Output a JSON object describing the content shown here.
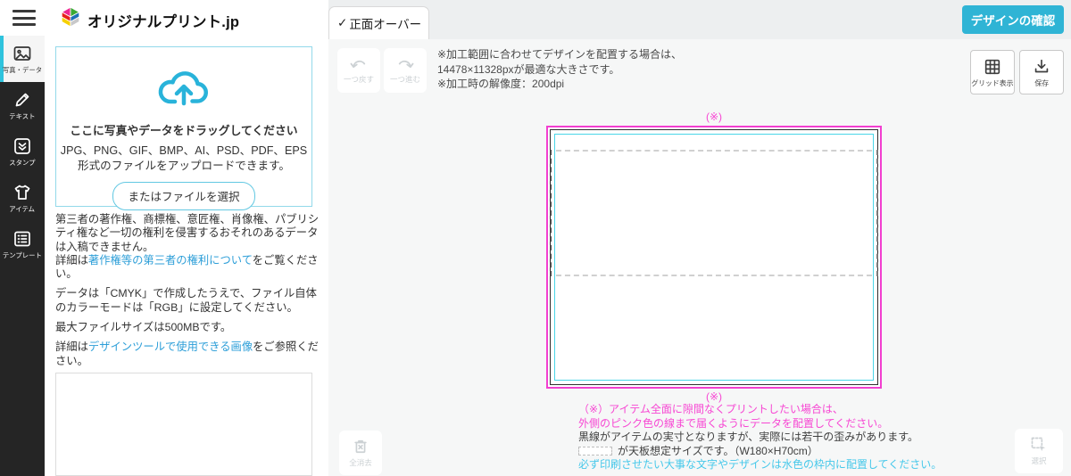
{
  "colors": {
    "accent_cyan": "#2fb4d5",
    "sidebar_active_cyan": "#2fc3dd",
    "link_blue": "#2c9ed8",
    "magenta_guide": "#f23fd0",
    "canvas_cyan_line": "#49d5e8",
    "note_cyan": "#46c8ea",
    "item_outline_black": "#2e2e2e"
  },
  "header": {
    "brand": "オリジナルプリント.jp",
    "confirm_button_label": "デザインの確認"
  },
  "tab": {
    "check": "✓",
    "label": "正面オーバー"
  },
  "sidebar": {
    "items": [
      {
        "label": "写真・データ",
        "icon": "photo-icon",
        "active": true
      },
      {
        "label": "テキスト",
        "icon": "pencil-icon",
        "active": false
      },
      {
        "label": "スタンプ",
        "icon": "stamp-icon",
        "active": false
      },
      {
        "label": "アイテム",
        "icon": "tshirt-icon",
        "active": false
      },
      {
        "label": "テンプレート",
        "icon": "template-icon",
        "active": false
      }
    ]
  },
  "upload_panel": {
    "dropzone_title": "ここに写真やデータをドラッグしてください",
    "formats_line1": "JPG、PNG、GIF、BMP、AI、PSD、PDF、EPS",
    "formats_line2": "形式のファイルをアップロードできます。",
    "select_file_button": "またはファイルを選択",
    "rights_paragraph": "第三者の著作権、商標権、意匠権、肖像権、パブリシティ権など一切の権利を侵害するおそれのあるデータは入稿できません。",
    "rights_detail_prefix": "詳細は",
    "rights_detail_link": "著作権等の第三者の権利について",
    "rights_detail_suffix": "をご覧ください。",
    "color_mode_paragraph": "データは「CMYK」で作成したうえで、ファイル自体のカラーモードは「RGB」に設定してください。",
    "max_file_size": "最大ファイルサイズは500MBです。",
    "detail_prefix": "詳細は",
    "detail_link": "デザインツールで使用できる画像",
    "detail_suffix": "をご参照ください。"
  },
  "toolbar": {
    "undo_label": "一つ戻す",
    "redo_label": "一つ進む",
    "grid_button_label": "グリッド表示",
    "save_button_label": "保存",
    "info_line1": "※加工範囲に合わせてデザインを配置する場合は、",
    "info_line2": "14478×11328pxが最適な大きさです。",
    "info_line3": "※加工時の解像度：200dpi"
  },
  "canvas": {
    "top_marker": "(※)",
    "bottom_marker": "(※)",
    "notes": {
      "line1": "（※）アイテム全面に隙間なくプリントしたい場合は、",
      "line2": "外側のピンク色の線まで届くようにデータを配置してください。",
      "line3": "黒線がアイテムの実寸となりますが、実際には若干の歪みがあります。",
      "line4_suffix": "が天板想定サイズです。（W180×H70cm）",
      "line5": "必ず印刷させたい大事な文字やデザインは水色の枠内に配置してください。"
    }
  },
  "footer_actions": {
    "clear_all_label": "全消去",
    "select_label": "選択"
  }
}
